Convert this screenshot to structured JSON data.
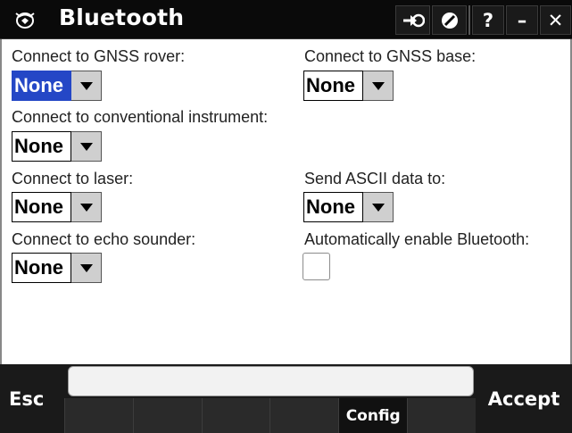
{
  "window": {
    "title": "Bluetooth",
    "help_label": "?",
    "minimize_label": "–",
    "close_label": "✕"
  },
  "form": {
    "gnss_rover": {
      "label": "Connect to GNSS rover:",
      "value": "None"
    },
    "gnss_base": {
      "label": "Connect to GNSS base:",
      "value": "None"
    },
    "conventional": {
      "label": "Connect to conventional instrument:",
      "value": "None"
    },
    "laser": {
      "label": "Connect to laser:",
      "value": "None"
    },
    "ascii": {
      "label": "Send ASCII data to:",
      "value": "None"
    },
    "echo": {
      "label": "Connect to echo sounder:",
      "value": "None"
    },
    "auto_enable": {
      "label": "Automatically enable Bluetooth:",
      "checked": false
    }
  },
  "bottom": {
    "esc_label": "Esc",
    "accept_label": "Accept",
    "softkeys": [
      "",
      "",
      "",
      "",
      "Config",
      ""
    ]
  },
  "colors": {
    "selection": "#2447c6",
    "titlebar": "#0a0a0a"
  },
  "icons": {
    "app": "trimble-globe-icon",
    "switch": "switch-to-icon",
    "no": "no-entry-icon"
  }
}
